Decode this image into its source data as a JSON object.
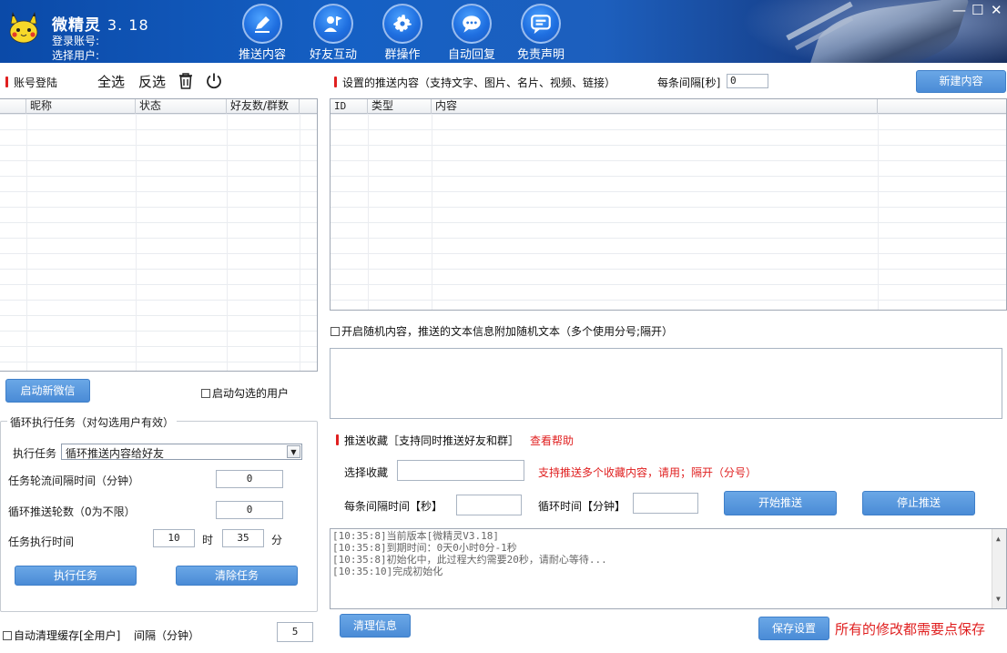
{
  "app": {
    "title": "微精灵",
    "version": "3. 18",
    "login_account_label": "登录账号:",
    "select_user_label": "选择用户:"
  },
  "nav": [
    {
      "label": "推送内容",
      "icon": "pen-icon"
    },
    {
      "label": "好友互动",
      "icon": "user-flag-icon"
    },
    {
      "label": "群操作",
      "icon": "gear-icon"
    },
    {
      "label": "自动回复",
      "icon": "chat-bubble-icon"
    },
    {
      "label": "免责声明",
      "icon": "message-lines-icon"
    }
  ],
  "window": {
    "minimize": "—",
    "maximize": "☐",
    "close": "✕"
  },
  "account": {
    "section_title": "账号登陆",
    "select_all": "全选",
    "invert_select": "反选",
    "columns": [
      "昵称",
      "状态",
      "好友数/群数"
    ],
    "rows": [],
    "start_new_button": "启动新微信",
    "start_checked_label": "启动勾选的用户"
  },
  "loop_task": {
    "group_title": "循环执行任务（对勾选用户有效）",
    "task_label": "执行任务",
    "task_selected": "循环推送内容给好友",
    "interval_label": "任务轮流间隔时间（分钟）",
    "interval_value": "0",
    "rounds_label": "循环推送轮数（0为不限）",
    "rounds_value": "0",
    "time_label": "任务执行时间",
    "hour_value": "10",
    "hour_unit": "时",
    "minute_value": "35",
    "minute_unit": "分",
    "execute_button": "执行任务",
    "clear_button": "清除任务"
  },
  "cache": {
    "label": "自动清理缓存[全用户]",
    "interval_label": "间隔（分钟）",
    "interval_value": "5"
  },
  "push_content": {
    "section_title": "设置的推送内容（支持文字、图片、名片、视频、链接）",
    "interval_label": "每条间隔[秒]",
    "interval_value": "0",
    "new_button": "新建内容",
    "columns": [
      "ID",
      "类型",
      "内容"
    ],
    "rows": []
  },
  "random": {
    "label": "开启随机内容，推送的文本信息附加随机文本（多个使用分号;隔开）",
    "text": ""
  },
  "favorites": {
    "section_title": "推送收藏［支持同时推送好友和群］",
    "help_link": "查看帮助",
    "select_label": "选择收藏",
    "select_value": "",
    "hint": "支持推送多个收藏内容，请用；隔开（分号）",
    "interval_label": "每条间隔时间【秒】",
    "interval_value": "",
    "cycle_label": "循环时间【分钟】",
    "cycle_value": "",
    "start_button": "开始推送",
    "stop_button": "停止推送"
  },
  "log": [
    "[10:35:8]当前版本[微精灵V3.18]",
    "[10:35:8]到期时间：0天0小时0分-1秒",
    "[10:35:8]初始化中，此过程大约需要20秒，请耐心等待...",
    "[10:35:10]完成初始化"
  ],
  "footer": {
    "clear_info_button": "清理信息",
    "save_button": "保存设置",
    "save_notice": "所有的修改都需要点保存"
  },
  "colors": {
    "accent_blue": "#4a8bd6",
    "header_blue": "#1560c4",
    "warning_red": "#e02020"
  }
}
